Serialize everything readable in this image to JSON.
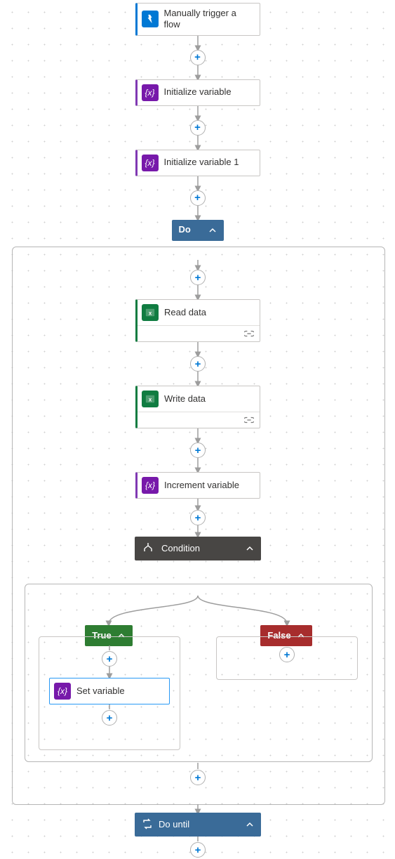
{
  "nodes": {
    "trigger": {
      "label": "Manually trigger a flow"
    },
    "init_var": {
      "label": "Initialize variable"
    },
    "init_var1": {
      "label": "Initialize variable 1"
    },
    "do": {
      "label": "Do"
    },
    "read_data": {
      "label": "Read data"
    },
    "write_data": {
      "label": "Write data"
    },
    "inc_var": {
      "label": "Increment variable"
    },
    "condition": {
      "label": "Condition"
    },
    "branch_true": {
      "label": "True"
    },
    "branch_false": {
      "label": "False"
    },
    "set_var": {
      "label": "Set variable"
    },
    "do_until": {
      "label": "Do until"
    }
  },
  "icons": {
    "var_glyph": "{x}",
    "excel_alt": "Excel"
  }
}
